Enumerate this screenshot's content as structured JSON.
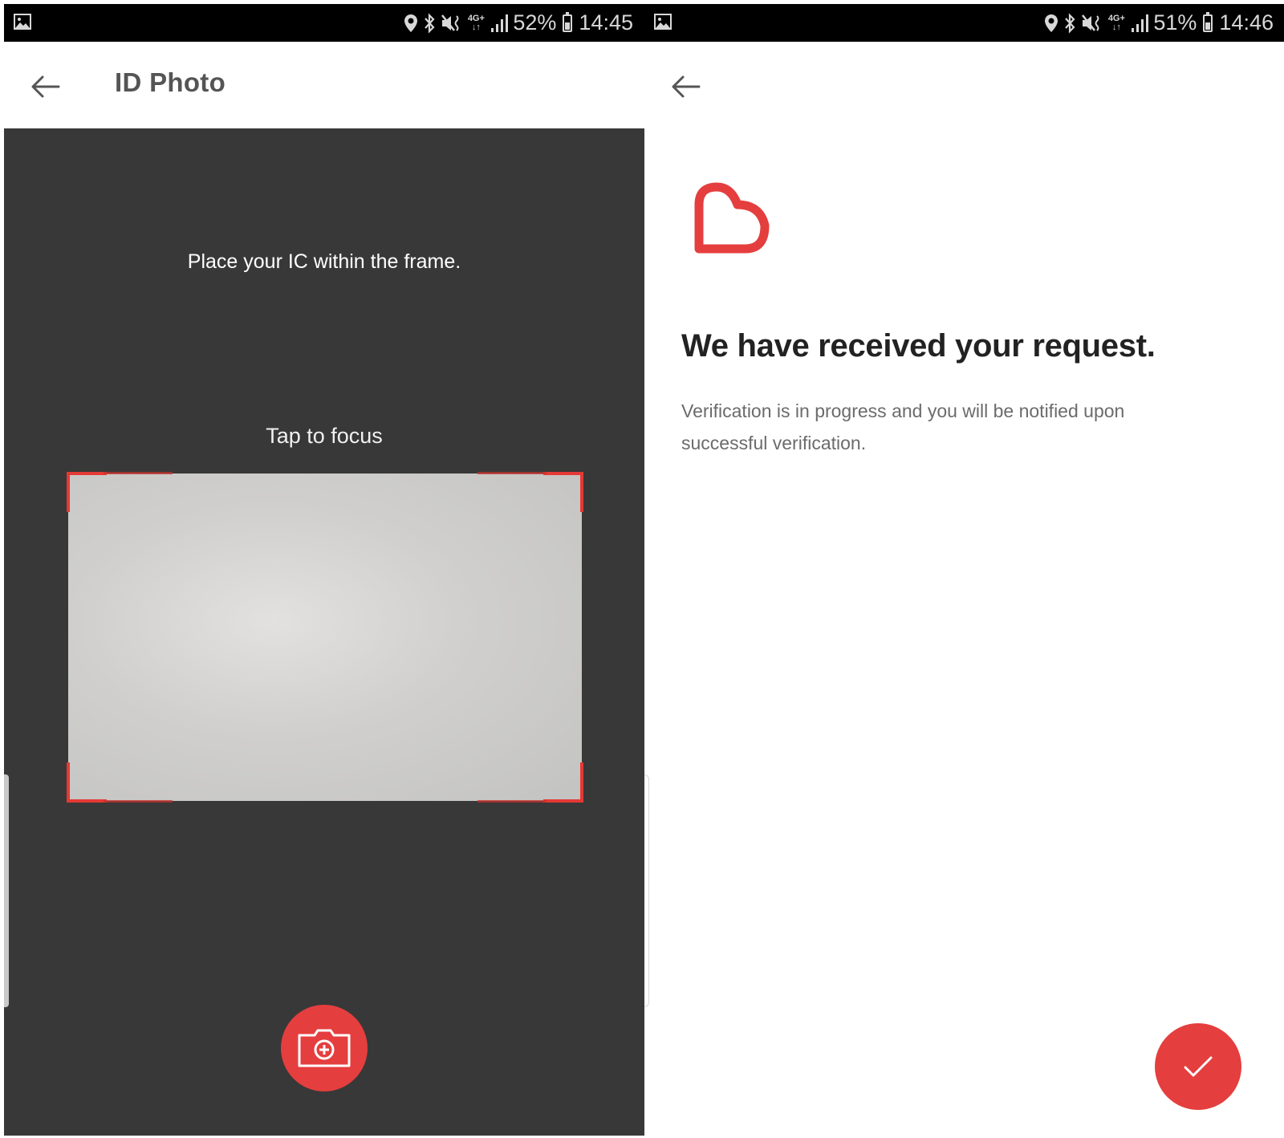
{
  "screens": [
    {
      "status_bar": {
        "battery": "52%",
        "time": "14:45",
        "network": "4G+",
        "icons": [
          "gallery-icon",
          "location-icon",
          "bluetooth-icon",
          "mute-vibrate-icon",
          "network-4g-icon",
          "signal-icon",
          "battery-icon"
        ]
      },
      "app_bar": {
        "back_icon": "arrow-left-icon",
        "title": "ID Photo"
      },
      "camera": {
        "instruction": "Place your IC within the frame.",
        "focus_hint": "Tap to focus",
        "capture_icon": "camera-plus-icon",
        "frame_color": "#e53935"
      }
    },
    {
      "status_bar": {
        "battery": "51%",
        "time": "14:46",
        "network": "4G+",
        "icons": [
          "gallery-icon",
          "location-icon",
          "bluetooth-icon",
          "mute-vibrate-icon",
          "network-4g-icon",
          "signal-icon",
          "battery-icon"
        ]
      },
      "app_bar": {
        "back_icon": "arrow-left-icon"
      },
      "confirmation": {
        "logo_icon": "heart-logo-icon",
        "headline": "We have received your request.",
        "body": "Verification is in progress and you will be notified upon successful verification.",
        "confirm_icon": "checkmark-icon"
      }
    }
  ],
  "colors": {
    "accent": "#e53e3e",
    "camera_bg": "#383838",
    "status_bar": "#000000",
    "title_text": "#555555",
    "headline_text": "#222222",
    "body_text": "#6b6b6b"
  }
}
